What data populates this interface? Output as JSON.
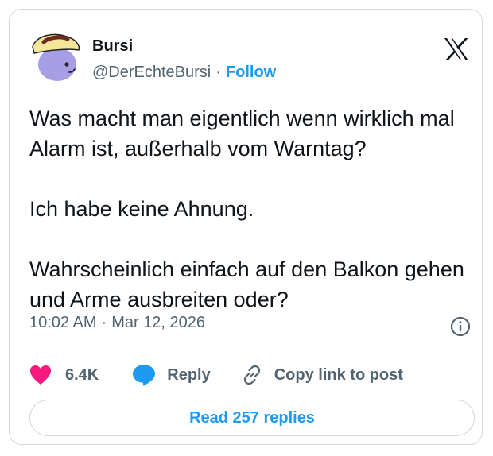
{
  "author": {
    "name": "Bursi",
    "handle": "@DerEchteBursi",
    "separator": "·",
    "follow_label": "Follow"
  },
  "logo_icon": "x-logo-icon",
  "tweet": {
    "paragraphs": [
      "Was macht man eigentlich wenn wirklich mal Alarm ist, außerhalb vom Warntag?",
      "Ich habe keine Ahnung.",
      "Wahrscheinlich einfach auf den Balkon gehen und Arme ausbreiten oder?"
    ],
    "time": "10:02 AM",
    "separator": "·",
    "date": "Mar 12, 2026",
    "info_icon": "info-icon"
  },
  "actions": {
    "like_count": "6.4K",
    "reply_label": "Reply",
    "copy_link_label": "Copy link to post"
  },
  "read_replies_label": "Read 257 replies",
  "colors": {
    "accent": "#1d9bf0",
    "like": "#f91880",
    "text": "#0f1419",
    "secondary": "#536471",
    "border": "#cfd9de"
  }
}
